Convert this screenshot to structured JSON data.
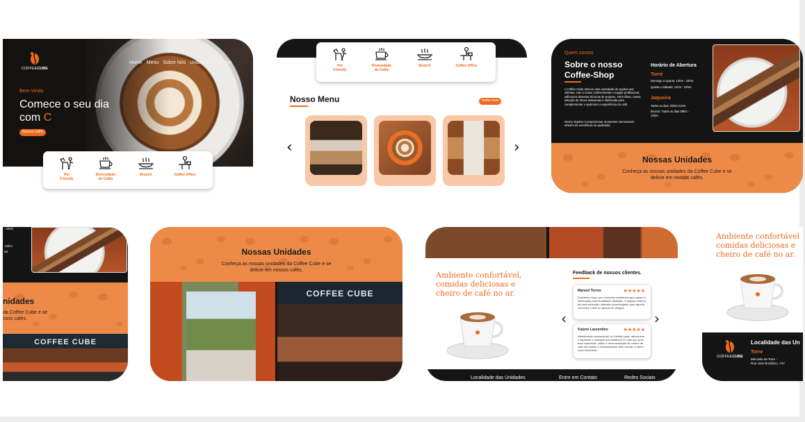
{
  "colors": {
    "accent": "#ee6a1c",
    "dark": "#141414",
    "orange_panel": "#ee8a48"
  },
  "brand": {
    "name": "COFFEE CUBE",
    "name_light": "COFFEE",
    "name_bold": "CUBE"
  },
  "hero": {
    "nav": [
      "Home",
      "Menu",
      "Sobre Nós",
      "Unidades",
      "Contato"
    ],
    "welcome": "Bem-Vindo",
    "headline_line1": "Comece o seu dia",
    "headline_line2": "com",
    "cursor": "C",
    "cta": "Nossos Cafés"
  },
  "features": [
    {
      "label": "Pet Friendly",
      "icon": "pet-friendly-icon"
    },
    {
      "label": "Diversidade de Cafés",
      "icon": "coffee-cup-icon"
    },
    {
      "label": "Brunch",
      "icon": "brunch-dish-icon"
    },
    {
      "label": "Coffee Office",
      "icon": "coffee-office-icon"
    }
  ],
  "feature_labels_split": {
    "pet": [
      "Pet",
      "Friendly"
    ],
    "diversidade": [
      "Diversidade",
      "de Cafés"
    ],
    "brunch": [
      "Brunch"
    ],
    "office": [
      "Coffee Office"
    ]
  },
  "menu": {
    "title": "Nosso Menu",
    "more": "Saiba mais"
  },
  "about": {
    "eyebrow": "Quem somos",
    "title_line1": "Sobre o nosso",
    "title_line2": "Coffee-Shop",
    "paragraph1": "A Coffee Cube oferece uma variedade de opções aos clientes, com o nosso conhecimento e equipe profissional, utilizamos diversas técnicas de preparo. Além disso, nossa seleção de doces artesanais é elaborada para complementar e aprimorar a experiência do café.",
    "paragraph2": "Nosso objetivo é proporcionar momentes memoráveis através da excelência na qualidade.",
    "hours_title": "Horário de Abertura",
    "torre_name": "Torre",
    "torre_hours_1": "Domingo a Quarta: 12hrs - 22hrs",
    "torre_hours_2": "Quinta a Sábado: 12hrs - 22hrs",
    "jaqueira_name": "Jaqueira",
    "jaqueira_hours_1": "Todos os dias: 09hrs-21hrs",
    "jaqueira_hours_2": "Brunch: Todos os dias 09hrs - 13hrs."
  },
  "units": {
    "title": "Nossas Unidades",
    "subtitle_line1": "Conheça as nossas unidades da Coffee Cube e se",
    "subtitle_line2": "delicie em nossos cafés."
  },
  "crop4": {
    "hours_fragment_1": "- 22hrs",
    "hours_fragment_2": "-21hrs",
    "hours_fragment_3": "ias",
    "title_fragment": "nidades",
    "sub_fragment_1": "da Coffee Cube e se",
    "sub_fragment_2": "ssos cafés."
  },
  "ambience": {
    "line1": "Ambiente confortável,",
    "line2": "comidas deliciosas e",
    "line3": "cheiro de café no ar.",
    "crop_line1": "Ambiente confortável",
    "crop_line2": "comidas deliciosas e",
    "crop_line3": "cheiro de café no ar."
  },
  "feedback": {
    "title": "Feedback de nossos clientes.",
    "reviews": [
      {
        "name": "Manoel Torres",
        "stars": "★★★★★",
        "text": "Excelente local, com inúmeros ambientes que variam a iluminação para finalidades distintas. O espaço externo dá uma sensação intimista aconchegante para aquela conversa a dois ou grupos de amigos."
      },
      {
        "name": "Kalyne Laurentino",
        "stars": "★★★★★",
        "text": "Atendimento sensacional, eu behida super atenciosos e explicam o cardápio nos detalhes! O Latte que pedi teve impecável, cálice a recomendação de combo de café da manhã, é extremamente bem servido e ótimo custo benefício!"
      }
    ]
  },
  "footer": {
    "col1": "Localidade das Unidades",
    "col2": "Entre em Contato",
    "col3": "Redes Sociais",
    "crop_title": "Localidade das Un",
    "torre": "Torre",
    "address_line1": "Mercado da Torre -",
    "address_line2": "Rua José Bonifácio, 747"
  },
  "icons": {
    "prev": "‹",
    "next": "›"
  }
}
